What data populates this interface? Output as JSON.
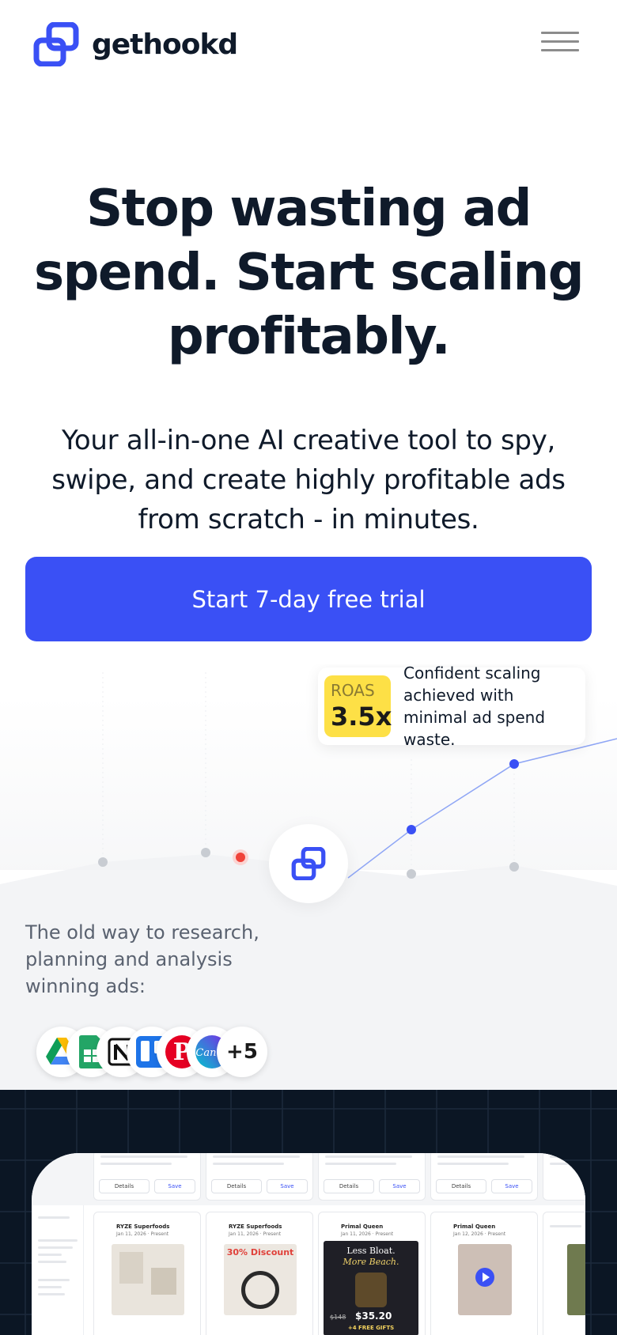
{
  "header": {
    "brand": "gethookd",
    "logo_icon": "link-chain-logo-icon",
    "menu_icon": "hamburger-menu-icon"
  },
  "hero": {
    "title": "Stop wasting ad spend. Start scaling profitably.",
    "subtitle": "Your all-in-one AI creative tool to spy, swipe, and create highly profitable ads from scratch - in minutes.",
    "cta_label": "Start 7-day free trial"
  },
  "roas_card": {
    "label": "ROAS",
    "value": "3.5x",
    "text": "Confident scaling achieved with minimal ad spend waste."
  },
  "old_way": {
    "text": "The old way to research, planning and analysis winning ads:",
    "tools": [
      "google-drive-icon",
      "google-sheets-icon",
      "notion-icon",
      "trello-icon",
      "pinterest-icon",
      "canva-icon"
    ],
    "more_label": "+5"
  },
  "preview": {
    "cards": [
      {
        "name": "RYZE Superfoods",
        "date": "Jan 11, 2026 · Present",
        "details": "Details",
        "save": "Save",
        "discount": ""
      },
      {
        "name": "RYZE Superfoods",
        "date": "Jan 11, 2026 · Present",
        "details": "Details",
        "save": "Save",
        "discount": "30% Discount"
      },
      {
        "name": "Primal Queen",
        "date": "Jan 11, 2026 · Present",
        "details": "Details",
        "save": "Save",
        "discount": ""
      },
      {
        "name": "Primal Queen",
        "date": "Jan 12, 2026 · Present",
        "details": "Details",
        "save": "Save",
        "discount": ""
      }
    ],
    "ad_copy": {
      "less_bloat": "Less Bloat.",
      "more_beach": "More Beach.",
      "old_price": "$148",
      "new_price": "$35.20",
      "gifts": "+4 FREE GIFTS"
    }
  },
  "colors": {
    "accent": "#3a50f5",
    "dark_bg": "#0b1624",
    "roas_yellow": "#fde046",
    "point_blue": "#3a50f5",
    "point_red": "#f0433a",
    "point_gray": "#c8ccd2"
  }
}
